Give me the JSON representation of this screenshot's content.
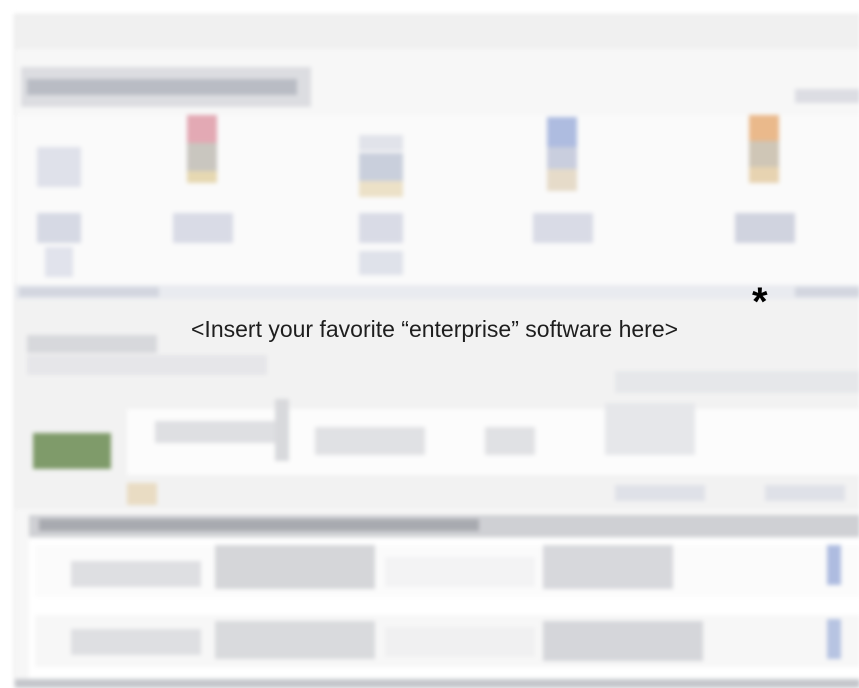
{
  "caption": {
    "text": "<Insert your favorite “enterprise” software here>",
    "asterisk": "*"
  },
  "colors": {
    "background": "#f7f7f7",
    "header_blocks": "#c9ccd3",
    "accent_green": "#7f9b6a",
    "accent_blue": "#aebce0",
    "accent_red": "#e3a9b4",
    "accent_orange": "#eab98b",
    "row_bar": "#c4c6cb"
  }
}
